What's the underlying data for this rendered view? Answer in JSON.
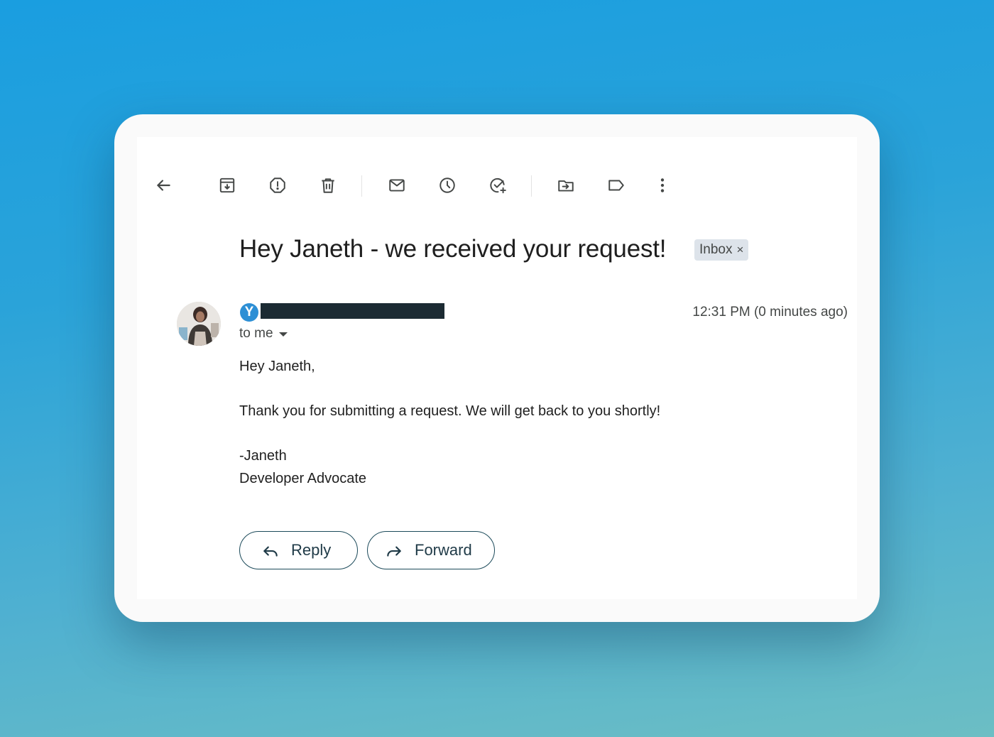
{
  "toolbar": {
    "icons": [
      "back-arrow-icon",
      "archive-icon",
      "report-spam-icon",
      "delete-icon",
      "mark-unread-icon",
      "snooze-icon",
      "add-to-tasks-icon",
      "move-to-icon",
      "label-icon",
      "more-options-icon"
    ]
  },
  "email": {
    "subject": "Hey Janeth - we received your request!",
    "label_chip": "Inbox",
    "label_chip_close": "×",
    "sender_logo_letter": "Y",
    "timestamp": "12:31 PM (0 minutes ago)",
    "recipient": "to me",
    "body": {
      "greeting": "Hey Janeth,",
      "message": "Thank you for submitting a request. We will get back to you shortly!",
      "signature_name": "-Janeth",
      "signature_title": "Developer Advocate"
    }
  },
  "actions": {
    "reply_label": "Reply",
    "forward_label": "Forward"
  },
  "colors": {
    "background_top": "#1a9ee0",
    "background_bottom": "#6cbec4",
    "button_border": "#1c4a5a",
    "chip_background": "#dde3ea",
    "sender_logo": "#2d8fd5"
  }
}
